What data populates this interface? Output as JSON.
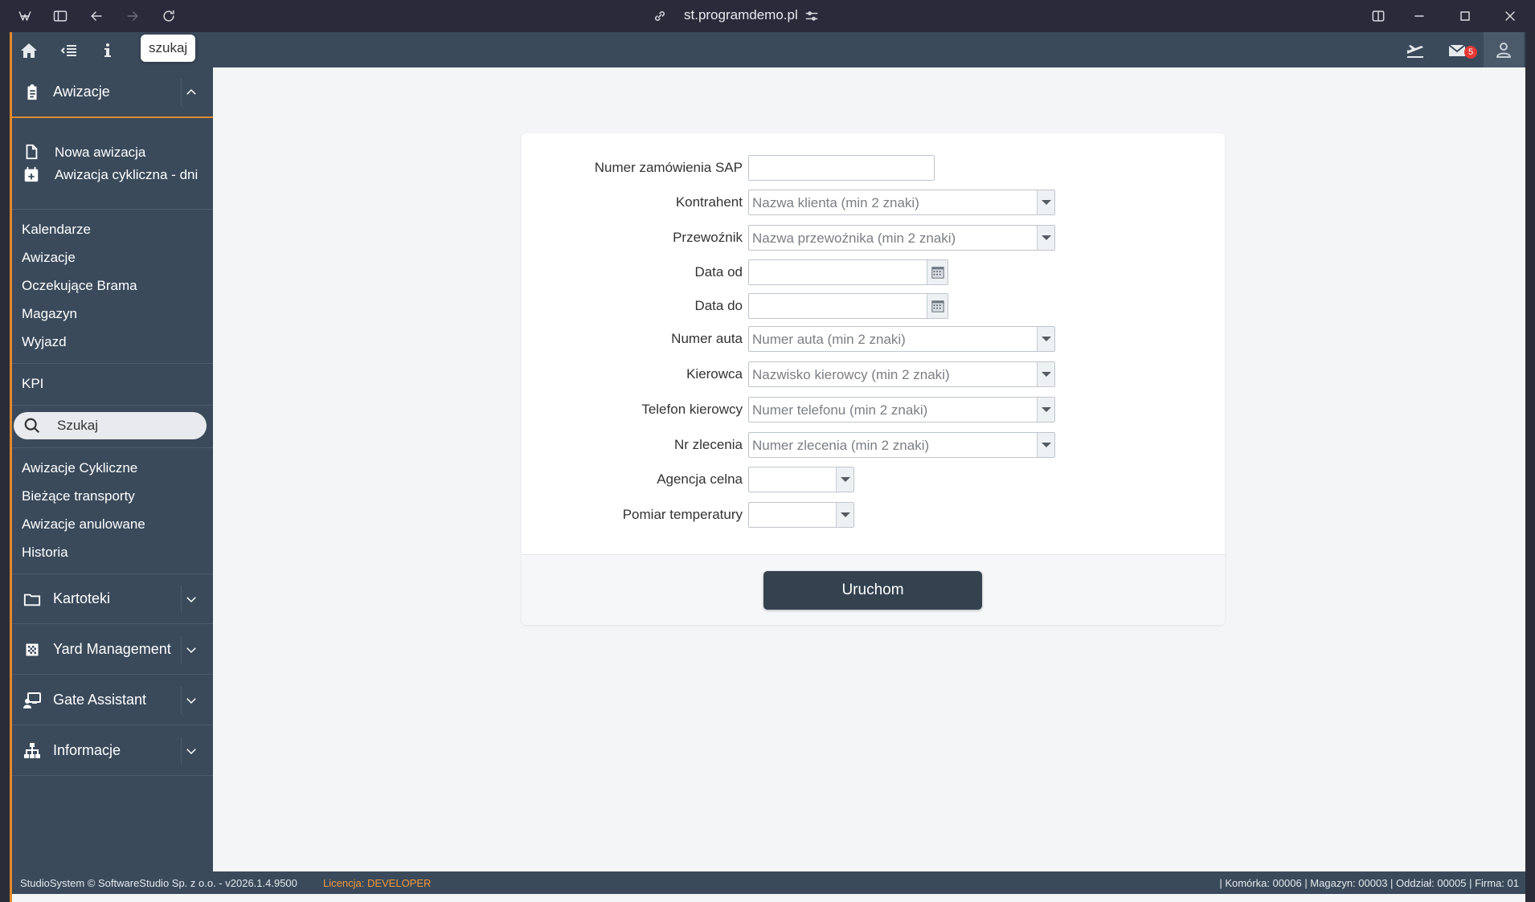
{
  "browser": {
    "url": "st.programdemo.pl",
    "icons": [
      "app-logo-icon",
      "sidebar-toggle-icon",
      "back-icon",
      "forward-icon",
      "reload-icon",
      "link-icon",
      "site-settings-icon",
      "split-view-icon",
      "minimize-icon",
      "maximize-icon",
      "close-icon"
    ]
  },
  "topbar": {
    "tooltip": "szukaj",
    "mail_badge": "5",
    "icons": [
      "home-icon",
      "collapse-menu-icon",
      "info-icon",
      "plane-icon",
      "mail-icon",
      "user-icon"
    ]
  },
  "sidebar": {
    "awizacje_header": "Awizacje",
    "sub_items": [
      {
        "label": "Nowa awizacja",
        "icon": "file-icon"
      },
      {
        "label": "Awizacja cykliczna - dni",
        "icon": "calendar-plus-icon"
      }
    ],
    "group1": [
      "Kalendarze",
      "Awizacje",
      "Oczekujące Brama",
      "Magazyn",
      "Wyjazd"
    ],
    "kpi": "KPI",
    "search_placeholder": "Szukaj",
    "group2": [
      "Awizacje Cykliczne",
      "Bieżące transporty",
      "Awizacje anulowane",
      "Historia"
    ],
    "sections": [
      {
        "label": "Kartoteki",
        "icon": "folder-icon"
      },
      {
        "label": "Yard Management",
        "icon": "grid-icon"
      },
      {
        "label": "Gate Assistant",
        "icon": "gate-assistant-icon"
      },
      {
        "label": "Informacje",
        "icon": "sitemap-icon"
      }
    ]
  },
  "form": {
    "fields": [
      {
        "label": "Numer zamówienia SAP",
        "type": "text",
        "placeholder": ""
      },
      {
        "label": "Kontrahent",
        "type": "combo",
        "placeholder": "Nazwa klienta (min 2 znaki)"
      },
      {
        "label": "Przewoźnik",
        "type": "combo",
        "placeholder": "Nazwa przewoźnika (min 2 znaki)"
      },
      {
        "label": "Data od",
        "type": "date",
        "placeholder": ""
      },
      {
        "label": "Data do",
        "type": "date",
        "placeholder": ""
      },
      {
        "label": "Numer auta",
        "type": "combo",
        "placeholder": "Numer auta (min 2 znaki)"
      },
      {
        "label": "Kierowca",
        "type": "combo",
        "placeholder": "Nazwisko kierowcy (min 2 znaki)"
      },
      {
        "label": "Telefon kierowcy",
        "type": "combo",
        "placeholder": "Numer telefonu (min 2 znaki)"
      },
      {
        "label": "Nr zlecenia",
        "type": "combo",
        "placeholder": "Numer zlecenia (min 2 znaki)"
      },
      {
        "label": "Agencja celna",
        "type": "select",
        "placeholder": ""
      },
      {
        "label": "Pomiar temperatury",
        "type": "select",
        "placeholder": ""
      }
    ],
    "submit": "Uruchom"
  },
  "status": {
    "left": "StudioSystem © SoftwareStudio Sp. z o.o. - v2026.1.4.9500",
    "license_prefix": "Licencja:",
    "license_value": "DEVELOPER",
    "right": "| Komórka: 00006 | Magazyn: 00003 | Oddział: 00005 | Firma: 01"
  }
}
